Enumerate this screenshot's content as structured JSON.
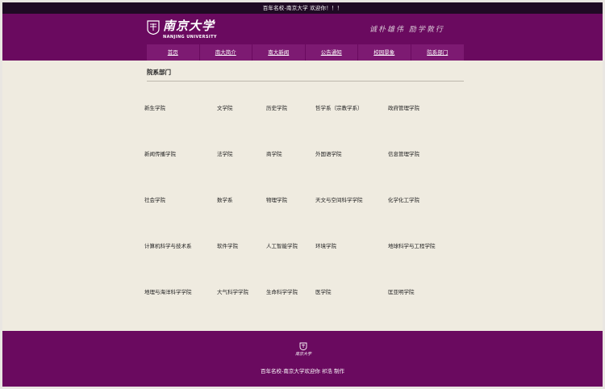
{
  "topbar": {
    "text": "百年名校-南京大学 欢迎你！！！"
  },
  "header": {
    "logo_cn": "南京大学",
    "logo_en": "NANJING UNIVERSITY",
    "motto": "诚朴雄伟 励学敦行"
  },
  "nav": {
    "items": [
      {
        "label": "首页"
      },
      {
        "label": "南大简介"
      },
      {
        "label": "南大新闻"
      },
      {
        "label": "公告通知"
      },
      {
        "label": "校园景象"
      },
      {
        "label": "院系部门"
      }
    ]
  },
  "content": {
    "title": "院系部门",
    "departments": [
      [
        "新生学院",
        "文学院",
        "历史学院",
        "哲学系（宗教学系）",
        "政府管理学院"
      ],
      [
        "新闻传播学院",
        "法学院",
        "商学院",
        "外国语学院",
        "信息管理学院"
      ],
      [
        "社会学院",
        "数学系",
        "物理学院",
        "天文与空间科学学院",
        "化学化工学院"
      ],
      [
        "计算机科学与技术系",
        "软件学院",
        "人工智能学院",
        "环境学院",
        "地球科学与工程学院"
      ],
      [
        "地理与海洋科学学院",
        "大气科学学院",
        "生命科学学院",
        "医学院",
        "匡亚明学院"
      ]
    ]
  },
  "footer": {
    "logo_cn": "南京大学",
    "text": "百年名校-南京大学欢迎你  祁浩  制作"
  }
}
